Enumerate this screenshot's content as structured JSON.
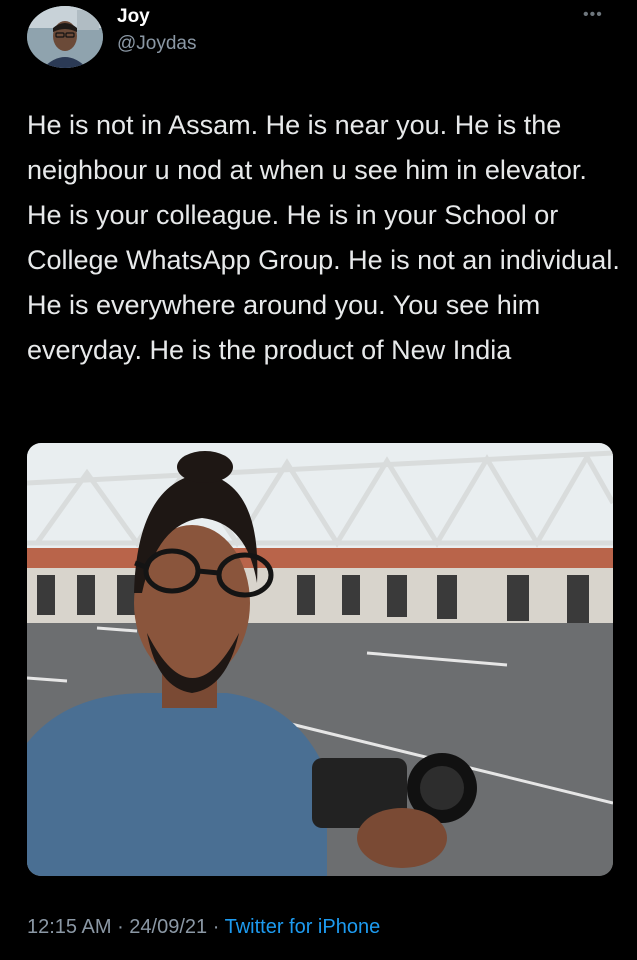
{
  "author": {
    "name": "Joy",
    "handle": "@Joydas",
    "avatar_icon": "profile-photo"
  },
  "more_icon": "more-options-icon",
  "more_glyph": "•••",
  "tweet": {
    "text": "He is not in Assam. He is near you. He is the neighbour u nod at when u see him in elevator. He is your colleague. He is in your School or College WhatsApp Group. He is not an individual. He is everywhere around you. You see him everyday. He is the product of New India"
  },
  "media": {
    "type": "photo"
  },
  "meta": {
    "time": "12:15 AM",
    "separator": " · ",
    "date": "24/09/21",
    "source": "Twitter for iPhone"
  },
  "colors": {
    "background": "#000000",
    "text": "#e7e9ea",
    "secondary_text": "#8b98a5",
    "link": "#1d9bf0"
  }
}
